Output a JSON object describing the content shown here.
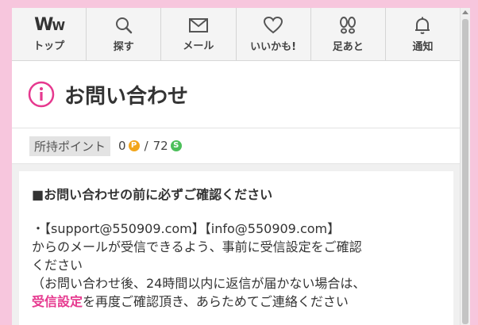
{
  "nav": [
    {
      "label": "トップ",
      "icon": "ww-logo-icon"
    },
    {
      "label": "探す",
      "icon": "search-icon"
    },
    {
      "label": "メール",
      "icon": "mail-icon"
    },
    {
      "label": "いいかも!",
      "icon": "heart-icon"
    },
    {
      "label": "足あと",
      "icon": "footprints-icon"
    },
    {
      "label": "通知",
      "icon": "bell-icon"
    }
  ],
  "logo_text": "WW",
  "title": "お問い合わせ",
  "points": {
    "label": "所持ポイント",
    "p_value": "0",
    "p_badge": "P",
    "separator": "/",
    "s_value": "72",
    "s_badge": "S"
  },
  "content": {
    "heading": "■お問い合わせの前に必ずご確認ください",
    "line1": "・【support@550909.com】【info@550909.com】",
    "line2": "からのメールが受信できるよう、事前に受信設定をご確認",
    "line3": "ください",
    "line4": "（お問い合わせ後、24時間以内に返信が届かない場合は、",
    "link_text": "受信設定",
    "line5_rest": "を再度ご確認頂き、あらためてご連絡ください"
  },
  "colors": {
    "accent": "#e6398f",
    "background": "#f7c6dd",
    "point_p": "#f2a51a",
    "point_s": "#4cbf5a"
  }
}
